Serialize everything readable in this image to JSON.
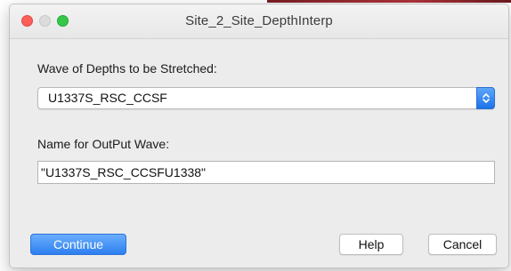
{
  "window": {
    "title": "Site_2_Site_DepthInterp"
  },
  "form": {
    "depth_wave_label": "Wave of Depths to be Stretched:",
    "depth_wave_selected": "U1337S_RSC_CCSF",
    "output_name_label": "Name for OutPut Wave:",
    "output_name_value": "\"U1337S_RSC_CCSFU1338\""
  },
  "buttons": {
    "continue": "Continue",
    "help": "Help",
    "cancel": "Cancel"
  },
  "icons": {
    "close": "close-icon",
    "minimize": "minimize-icon",
    "zoom": "zoom-icon",
    "popup_stepper": "chevron-updown-icon"
  },
  "colors": {
    "accent": "#2d7ff0",
    "close": "#fc5f57",
    "zoom": "#34c748"
  }
}
